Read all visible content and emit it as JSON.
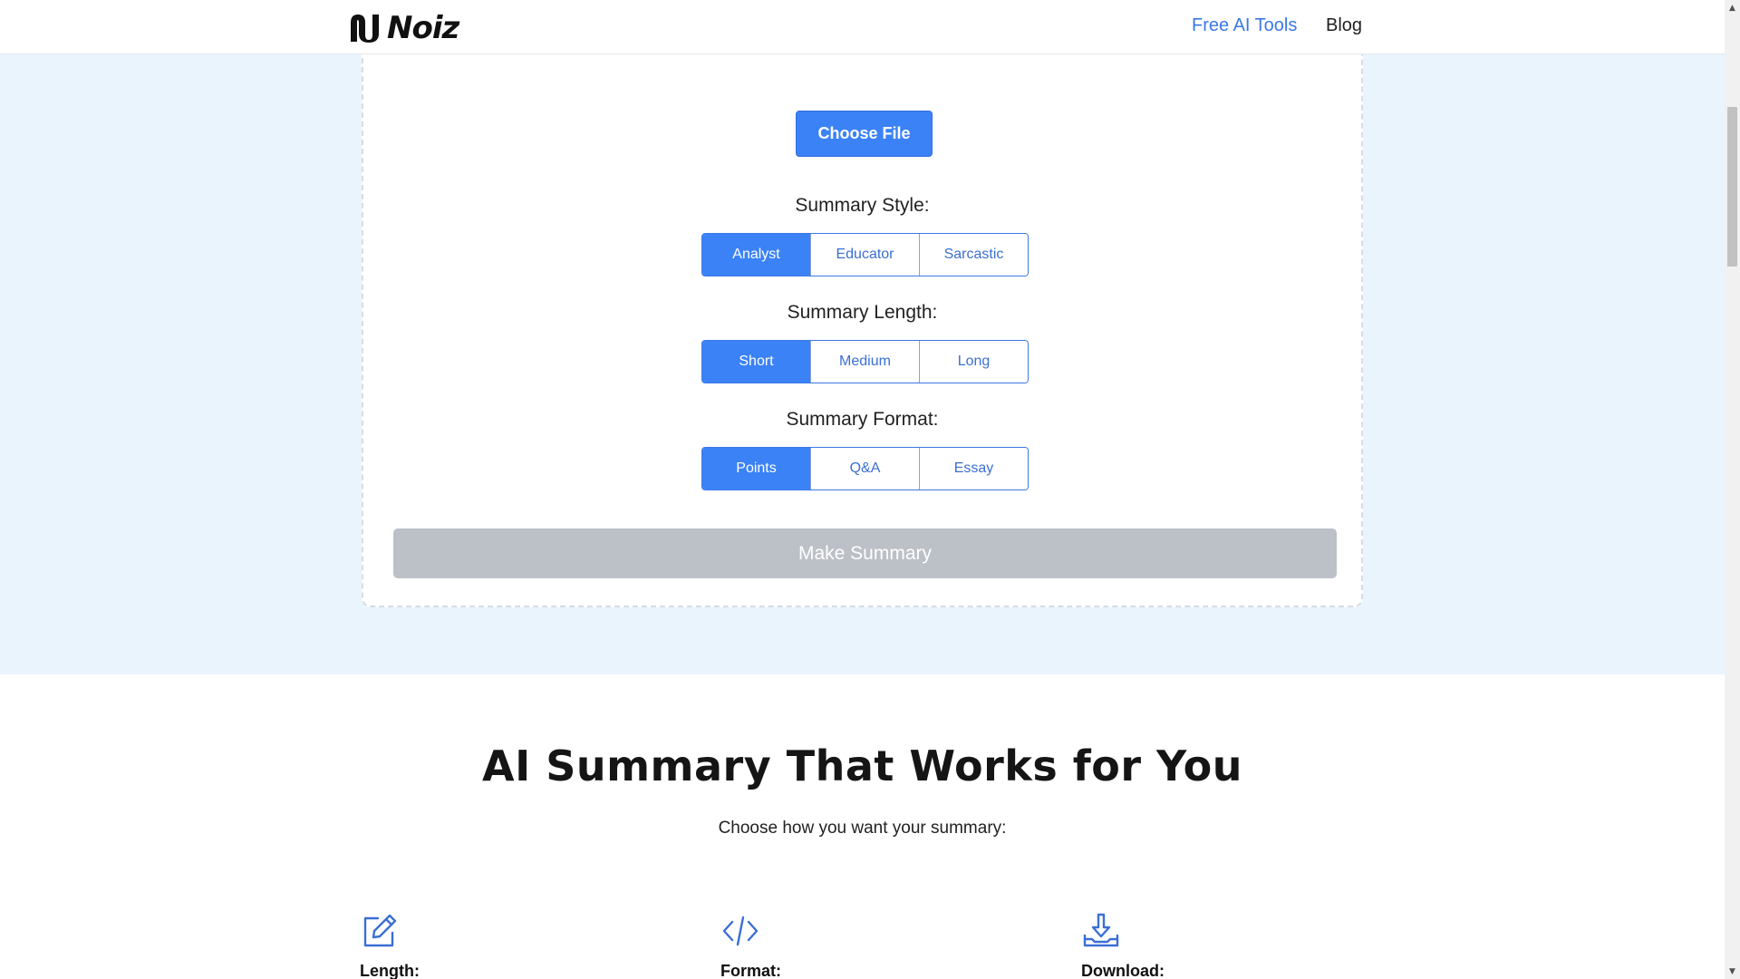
{
  "header": {
    "brand": "Noiz",
    "nav": [
      {
        "label": "Free AI Tools"
      },
      {
        "label": "Blog"
      }
    ]
  },
  "uploader": {
    "choose_file_label": "Choose File"
  },
  "options": {
    "style": {
      "label": "Summary Style:",
      "choices": [
        "Analyst",
        "Educator",
        "Sarcastic"
      ],
      "selected": "Analyst"
    },
    "length": {
      "label": "Summary Length:",
      "choices": [
        "Short",
        "Medium",
        "Long"
      ],
      "selected": "Short"
    },
    "format": {
      "label": "Summary Format:",
      "choices": [
        "Points",
        "Q&A",
        "Essay"
      ],
      "selected": "Points"
    }
  },
  "make_summary_label": "Make Summary",
  "features": {
    "title": "AI Summary That Works for You",
    "subtitle": "Choose how you want your summary:",
    "items": [
      {
        "icon": "edit-icon",
        "label": "Length:"
      },
      {
        "icon": "code-icon",
        "label": "Format:"
      },
      {
        "icon": "download-icon",
        "label": "Download:"
      }
    ]
  },
  "colors": {
    "accent": "#3b82f6",
    "hero_bg": "#e9f4fd",
    "disabled_button": "#bcc0c7"
  }
}
